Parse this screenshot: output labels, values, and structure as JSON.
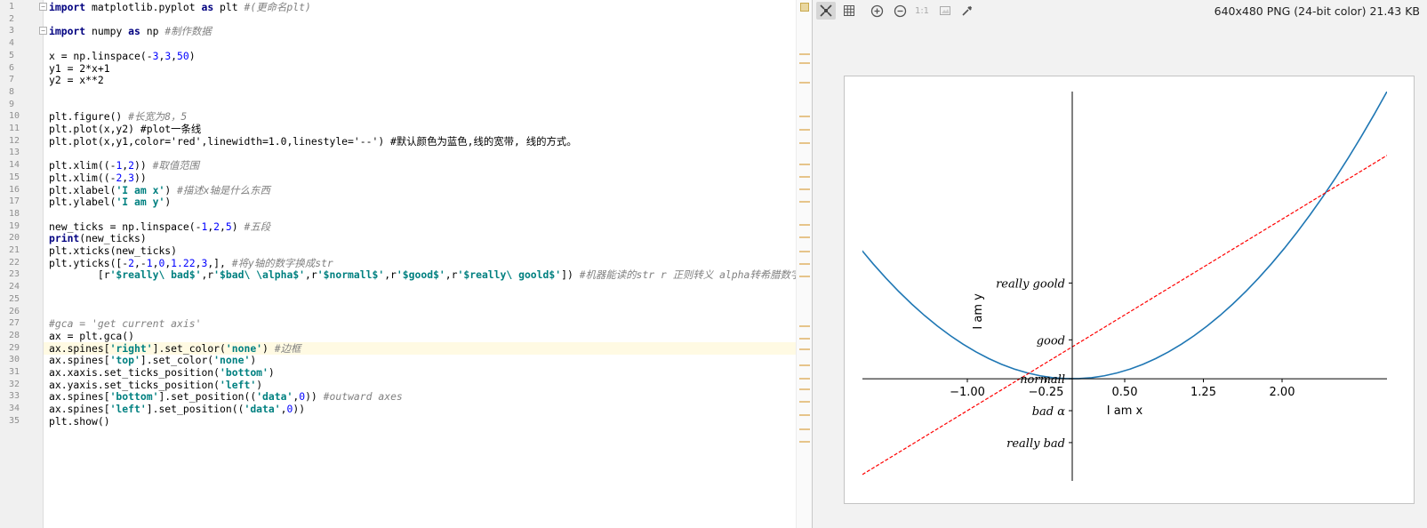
{
  "editor": {
    "line_numbers": [
      "1",
      "2",
      "3",
      "4",
      "5",
      "6",
      "7",
      "8",
      "9",
      "10",
      "11",
      "12",
      "13",
      "14",
      "15",
      "16",
      "17",
      "18",
      "19",
      "20",
      "21",
      "22",
      "23",
      "24",
      "25",
      "26",
      "27",
      "28",
      "29",
      "30",
      "31",
      "32",
      "33",
      "34",
      "35"
    ],
    "current_line": 29,
    "lines": [
      "import matplotlib.pyplot as plt #(更命名plt)",
      "",
      "import numpy as np #制作数据",
      "",
      "x = np.linspace(-3,3,50)",
      "y1 = 2*x+1",
      "y2 = x**2",
      "",
      "",
      "plt.figure() #长宽为8，5",
      "plt.plot(x,y2) #plot一条线",
      "plt.plot(x,y1,color='red',linewidth=1.0,linestyle='--') #默认颜色为蓝色,线的宽带, 线的方式。",
      "",
      "plt.xlim((-1,2)) #取值范围",
      "plt.xlim((-2,3))",
      "plt.xlabel('I am x') #描述x轴是什么东西",
      "plt.ylabel('I am y')",
      "",
      "new_ticks = np.linspace(-1,2,5) #五段",
      "print(new_ticks)",
      "plt.xticks(new_ticks)",
      "plt.yticks([-2,-1,0,1.22,3,], #将y轴的数字换成str",
      "        [r'$really\\ bad$',r'$bad\\ \\alpha$',r'$normall$',r'$good$',r'$really\\ goold$']) #机器能读的str r 正则转义 alpha转希腊数字",
      "",
      "",
      "",
      "#gca = 'get current axis'",
      "ax = plt.gca()",
      "ax.spines['right'].set_color('none') #边框",
      "ax.spines['top'].set_color('none')",
      "ax.xaxis.set_ticks_position('bottom')",
      "ax.yaxis.set_ticks_position('left')",
      "ax.spines['bottom'].set_position(('data',0)) #outward axes",
      "ax.spines['left'].set_position(('data',0))",
      "plt.show()"
    ]
  },
  "viewer": {
    "image_info": "640x480 PNG (24-bit color) 21.43 KB",
    "toolbar_icons": [
      "fit-icon",
      "grid-icon",
      "zoom-in-icon",
      "zoom-out-icon",
      "actual-size-icon",
      "background-icon",
      "color-picker-icon"
    ],
    "actual_size_label": "1:1"
  },
  "chart_data": {
    "type": "line",
    "xlabel": "I am x",
    "ylabel": "I am y",
    "xlim": [
      -2,
      3
    ],
    "ylim": [
      -3.2,
      9
    ],
    "xticks": [
      -1.0,
      -0.25,
      0.5,
      1.25,
      2.0
    ],
    "xtick_labels": [
      "−1.00",
      "−0.25",
      "0.50",
      "1.25",
      "2.00"
    ],
    "yticks": [
      -2,
      -1,
      0,
      1.22,
      3
    ],
    "ytick_labels": [
      "really bad",
      "bad α",
      "normall",
      "good",
      "really goold"
    ],
    "series": [
      {
        "formula": "x**2",
        "x_range": [
          -3,
          3
        ],
        "points": 50,
        "color": "#1f77b4",
        "style": "solid"
      },
      {
        "formula": "2*x+1",
        "x_range": [
          -3,
          3
        ],
        "points": 50,
        "color": "#ff0000",
        "style": "dashed"
      }
    ],
    "spines": {
      "left_at": 0,
      "bottom_at": 0,
      "right": "none",
      "top": "none"
    }
  }
}
